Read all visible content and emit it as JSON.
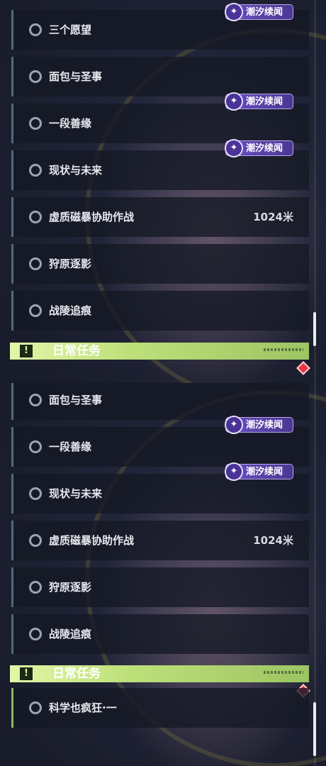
{
  "colors": {
    "tag_purple": "#5a40b0",
    "section_green": "#bde07a",
    "row_border": "#4f6a80",
    "active_row_border": "#8fb56a",
    "badge_red": "#e7344a"
  },
  "icons": {
    "radio": "radio-circle-icon",
    "tag": "tide-sequel-logo-icon",
    "section": "exclamation-icon"
  },
  "tag_label": "潮汐续闻",
  "section": {
    "title": "日常任务",
    "icon_glyph": "!"
  },
  "top_list": [
    {
      "label": "三个愿望",
      "tag": true
    },
    {
      "label": "面包与圣事"
    },
    {
      "label": "一段善缘",
      "tag": true
    },
    {
      "label": "现状与未来",
      "tag": true
    },
    {
      "label": "虚质磁暴协助作战",
      "distance": "1024米"
    },
    {
      "label": "狩原逐影"
    },
    {
      "label": "战陵追痕"
    }
  ],
  "bottom_list": [
    {
      "label": "面包与圣事"
    },
    {
      "label": "一段善缘",
      "tag": true
    },
    {
      "label": "现状与未来",
      "tag": true
    },
    {
      "label": "虚质磁暴协助作战",
      "distance": "1024米"
    },
    {
      "label": "狩原逐影"
    },
    {
      "label": "战陵追痕"
    }
  ],
  "daily_tasks": [
    {
      "label": "科学也疯狂·一"
    }
  ]
}
